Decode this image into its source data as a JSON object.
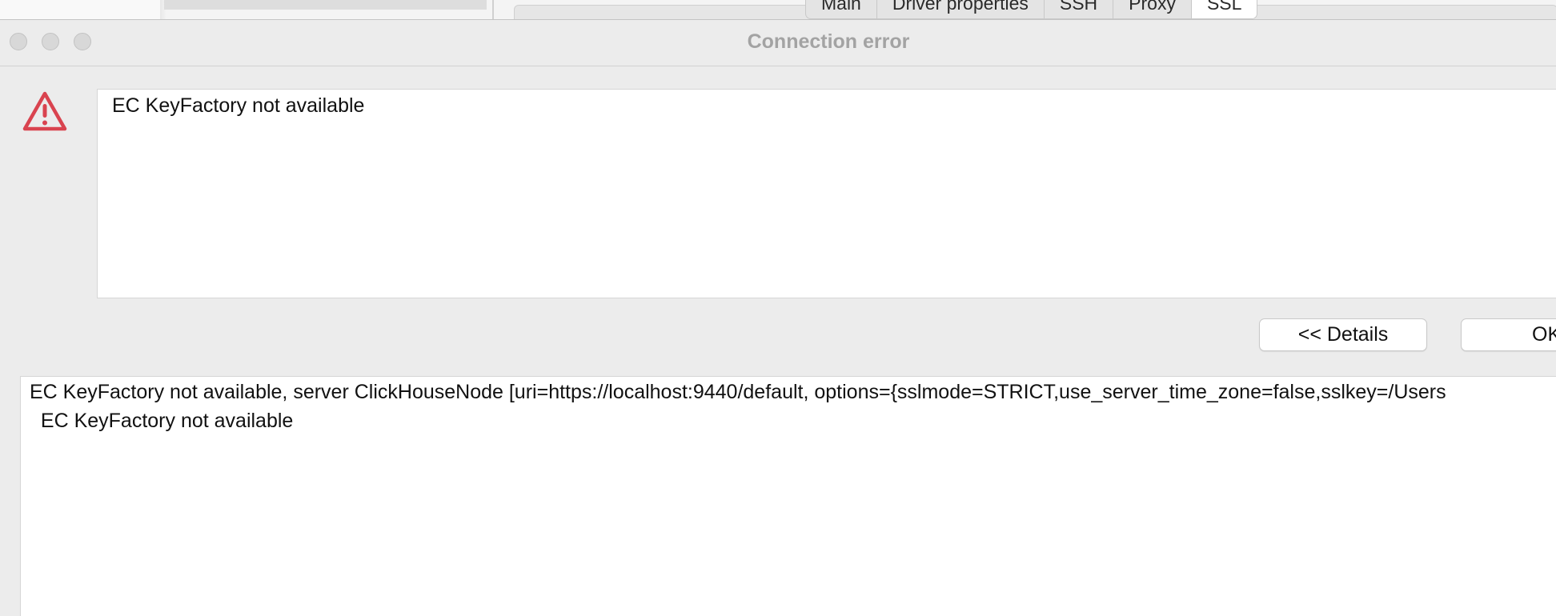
{
  "background_window": {
    "tabs": [
      {
        "label": "Main",
        "active": false
      },
      {
        "label": "Driver properties",
        "active": false
      },
      {
        "label": "SSH",
        "active": false
      },
      {
        "label": "Proxy",
        "active": false
      },
      {
        "label": "SSL",
        "active": true
      }
    ]
  },
  "dialog": {
    "title": "Connection error",
    "icon": "warning-triangle-icon",
    "icon_color": "#d9434f",
    "message": "EC KeyFactory not available",
    "buttons": {
      "details_label": "<< Details",
      "ok_label": "OK"
    },
    "details": {
      "line1": "EC KeyFactory not available, server ClickHouseNode [uri=https://localhost:9440/default, options={sslmode=STRICT,use_server_time_zone=false,sslkey=/Users",
      "line2": "  EC KeyFactory not available"
    }
  }
}
